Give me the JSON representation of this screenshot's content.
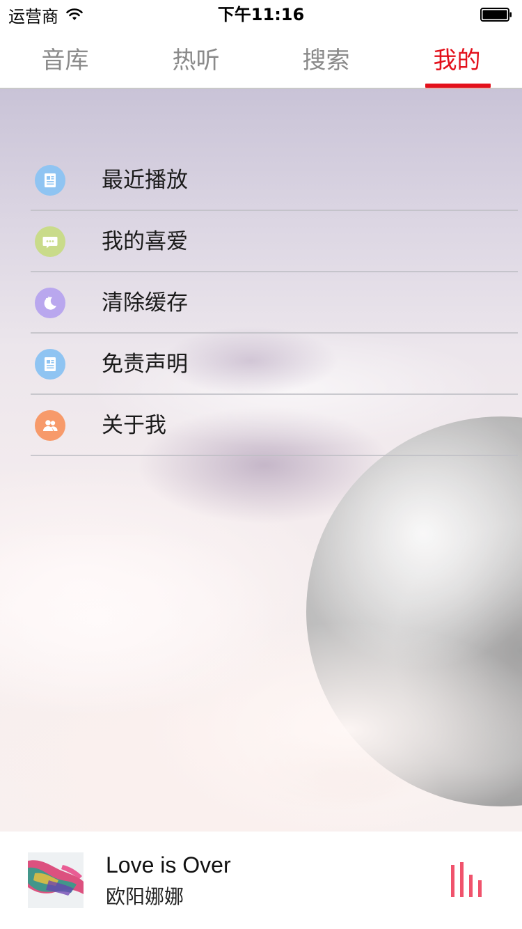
{
  "status_bar": {
    "carrier": "运营商",
    "time": "下午11:16"
  },
  "tabs": [
    {
      "label": "音库",
      "active": false
    },
    {
      "label": "热听",
      "active": false
    },
    {
      "label": "搜索",
      "active": false
    },
    {
      "label": "我的",
      "active": true
    }
  ],
  "menu": {
    "items": [
      {
        "label": "最近播放",
        "icon": "document-icon",
        "icon_color": "#8fc4f2"
      },
      {
        "label": "我的喜爱",
        "icon": "chat-bubble-icon",
        "icon_color": "#c9db8a"
      },
      {
        "label": "清除缓存",
        "icon": "moon-icon",
        "icon_color": "#b9a7ee"
      },
      {
        "label": "免责声明",
        "icon": "document-icon",
        "icon_color": "#8fc4f2"
      },
      {
        "label": "关于我",
        "icon": "users-icon",
        "icon_color": "#f79a6a"
      }
    ]
  },
  "player": {
    "title": "Love is Over",
    "artist": "欧阳娜娜",
    "equalizer_color": "#f0536c"
  },
  "colors": {
    "accent": "#e3101b",
    "tab_inactive": "#8a8a8a"
  }
}
